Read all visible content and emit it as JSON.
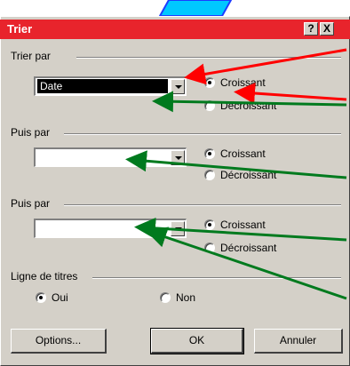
{
  "dialog": {
    "title": "Trier",
    "help_label": "?",
    "close_label": "X"
  },
  "groups": [
    {
      "label": "Trier par",
      "value": "Date",
      "asc": "Croissant",
      "desc": "Décroissant",
      "asc_checked": true
    },
    {
      "label": "Puis par",
      "value": "",
      "asc": "Croissant",
      "desc": "Décroissant",
      "asc_checked": true
    },
    {
      "label": "Puis par",
      "value": "",
      "asc": "Croissant",
      "desc": "Décroissant",
      "asc_checked": true
    }
  ],
  "header_row": {
    "label": "Ligne de titres",
    "yes": "Oui",
    "no": "Non",
    "selected": "Oui"
  },
  "buttons": {
    "options": "Options...",
    "ok": "OK",
    "cancel": "Annuler"
  },
  "colors": {
    "titlebar": "#e8242c",
    "dialog_bg": "#d4d0c8",
    "red_arrow": "#ff0000",
    "green_arrow": "#007a1e",
    "decor_blue": "#1e90ff"
  }
}
